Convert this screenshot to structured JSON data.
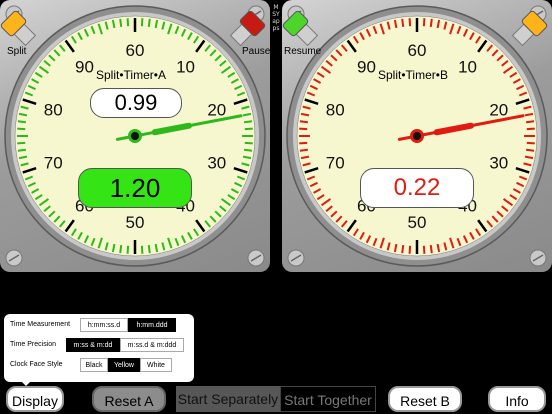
{
  "app": {
    "vendor": "MSYapps"
  },
  "timer_a": {
    "title": "Split•Timer•A",
    "split_reading": "0.99",
    "main_reading": "1.20",
    "left_button_label": "Split",
    "right_button_label": "Pause",
    "accent": "#2fb81a",
    "face_color": "#f6f7cf",
    "dial_numbers": [
      "60",
      "10",
      "20",
      "30",
      "40",
      "50",
      "60",
      "70",
      "80",
      "90"
    ],
    "hand_value_seconds": 22
  },
  "timer_b": {
    "title": "Split•Timer•B",
    "main_reading": "0.22",
    "left_button_label": "Resume",
    "accent": "#e01b10",
    "face_color": "#f6f7cf",
    "dial_numbers": [
      "60",
      "10",
      "20",
      "30",
      "40",
      "50",
      "60",
      "70",
      "80",
      "90"
    ],
    "hand_value_seconds": 22
  },
  "settings": {
    "time_measurement": {
      "label": "Time Measurement",
      "options": [
        "h:mm:ss.d",
        "h:mm.ddd"
      ],
      "selected": "h:mm.ddd"
    },
    "time_precision": {
      "label": "Time Precision",
      "options": [
        "m:ss & m:dd",
        "m:ss.d & m:ddd"
      ],
      "selected": "m:ss & m:dd"
    },
    "clock_face_style": {
      "label": "Clock Face Style",
      "options": [
        "Black",
        "Yellow",
        "White"
      ],
      "selected": "Yellow"
    }
  },
  "toolbar": {
    "display": "Display",
    "reset_a": "Reset A",
    "start_separately": "Start Separately",
    "start_together": "Start Together",
    "reset_b": "Reset B",
    "info": "Info"
  }
}
